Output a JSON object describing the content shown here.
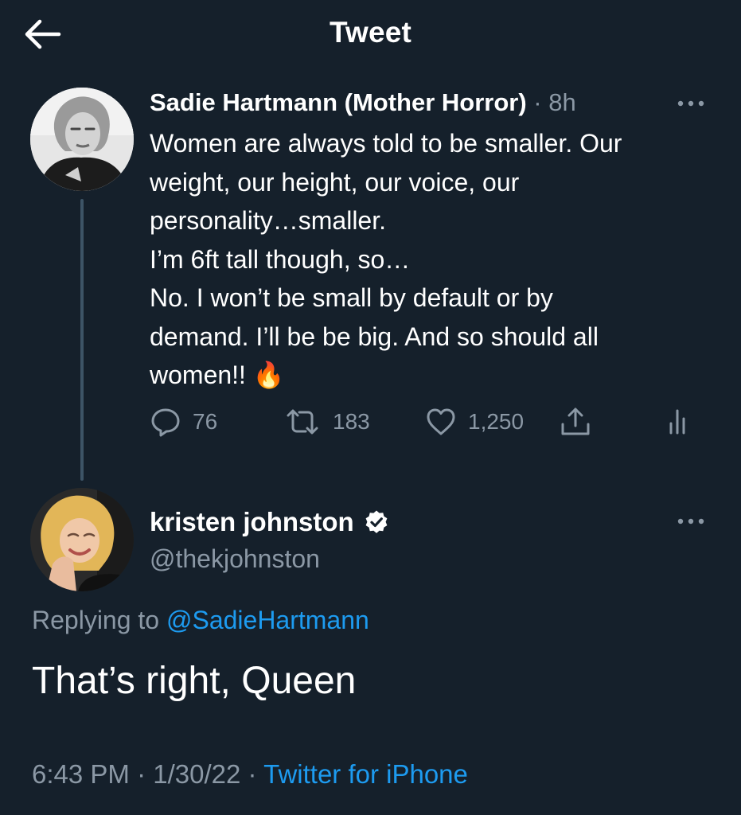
{
  "header": {
    "title": "Tweet",
    "back_icon": "arrow-left-icon"
  },
  "parent_tweet": {
    "author_name": "Sadie Hartmann (Mother Horror)",
    "separator": "·",
    "time": "8h",
    "text_lines": [
      "Women are always told to be smaller. Our",
      "weight, our height, our voice, our",
      "personality…smaller.",
      "I’m 6ft tall though, so…",
      "No. I won’t be small by default or by",
      "demand. I’ll be be big. And so should all",
      "women!!"
    ],
    "emoji": "🔥",
    "actions": {
      "replies": "76",
      "retweets": "183",
      "likes": "1,250"
    }
  },
  "reply_tweet": {
    "author_name": "kristen johnston",
    "handle": "@thekjohnston",
    "replying_prefix": "Replying to",
    "replying_to": "@SadieHartmann",
    "text": "That’s right, Queen",
    "meta": {
      "time": "6:43 PM",
      "sep1": "·",
      "date": "1/30/22",
      "sep2": "·",
      "source": "Twitter for iPhone"
    }
  },
  "colors": {
    "background": "#15202b",
    "muted": "#8b98a5",
    "accent": "#1d9bf0",
    "thread_line": "#3d5466"
  }
}
